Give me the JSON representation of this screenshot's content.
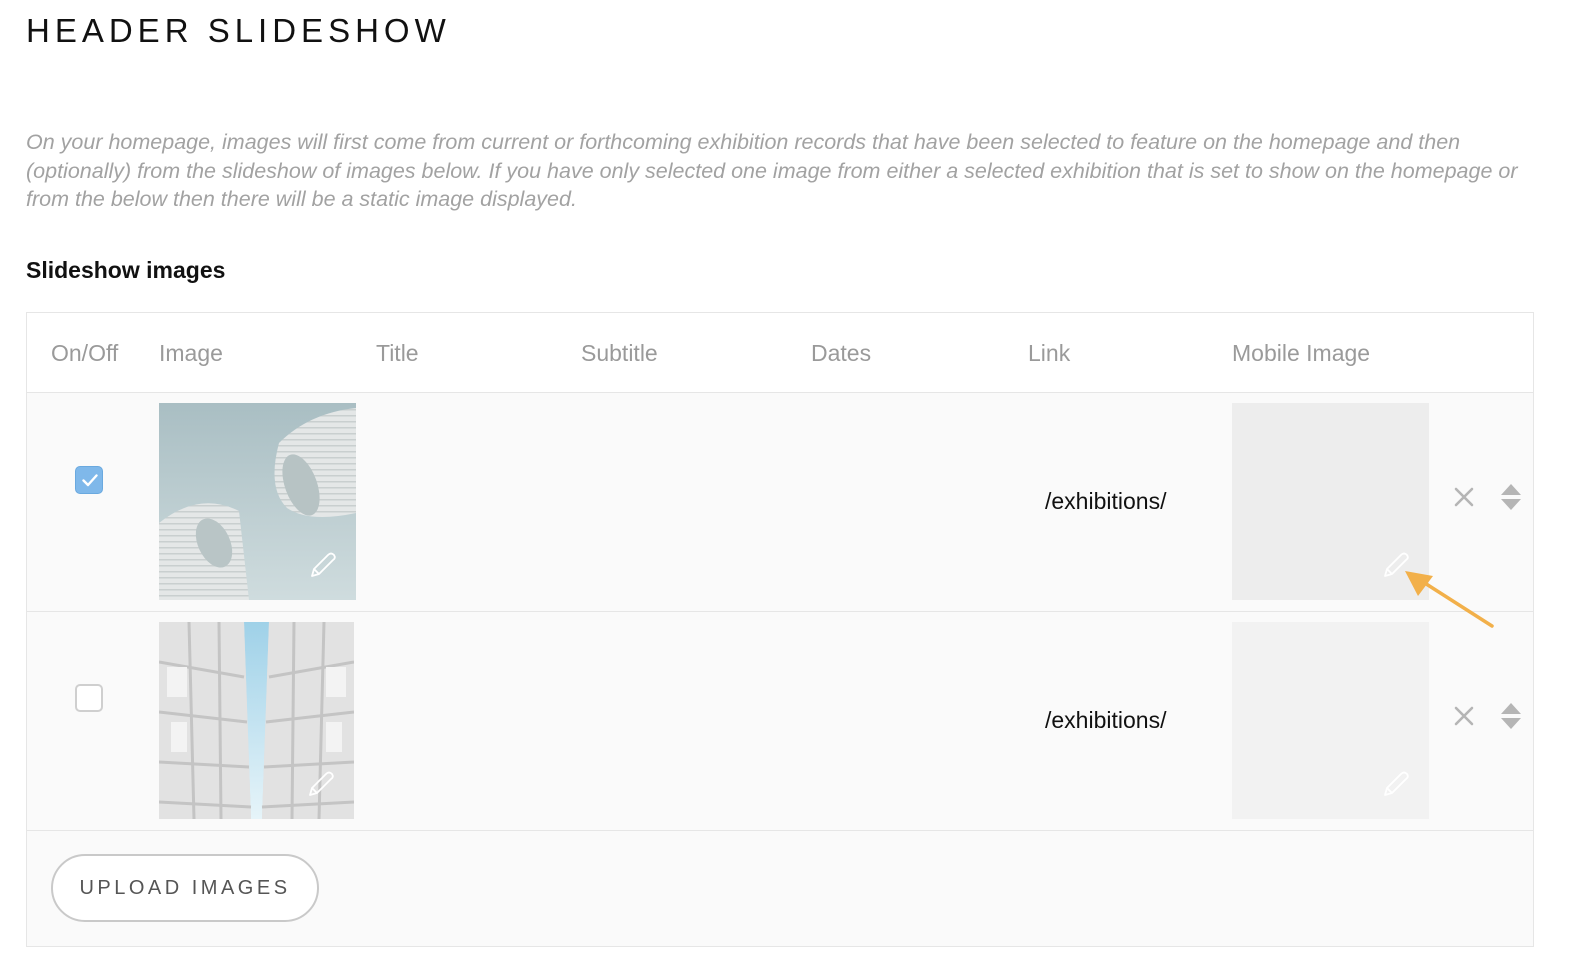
{
  "page_title": "HEADER SLIDESHOW",
  "intro_text": "On your homepage, images will first come from current or forthcoming exhibition records that have been selected to feature on the homepage and then (optionally) from the slideshow of images below. If you have only selected one image from either a selected exhibition that is set to show on the homepage or from the below then there will be a static image displayed.",
  "section_label": "Slideshow images",
  "table": {
    "columns": [
      "On/Off",
      "Image",
      "Title",
      "Subtitle",
      "Dates",
      "Link",
      "Mobile Image"
    ],
    "rows": [
      {
        "enabled": true,
        "image": "architecture-towers-photo",
        "title": "",
        "subtitle": "",
        "dates": "",
        "link": "/exhibitions/",
        "mobile_image": ""
      },
      {
        "enabled": false,
        "image": "symmetric-building-photo",
        "title": "",
        "subtitle": "",
        "dates": "",
        "link": "/exhibitions/",
        "mobile_image": ""
      }
    ]
  },
  "upload_button": "UPLOAD IMAGES",
  "colors": {
    "checkbox_on": "#7fb8ea",
    "annotation_arrow": "#f2b04a",
    "muted_text": "#a2a2a2"
  },
  "icons": [
    "check-icon",
    "pencil-icon",
    "close-icon",
    "sort-icon",
    "arrow-annotation"
  ]
}
